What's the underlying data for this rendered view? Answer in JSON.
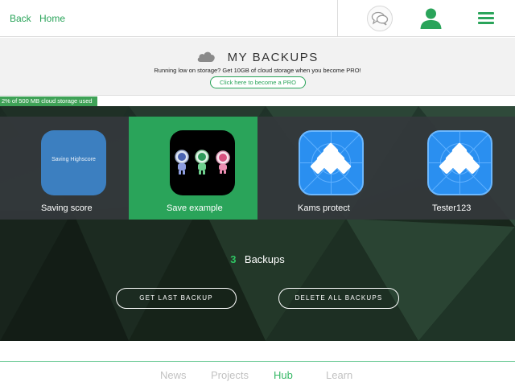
{
  "topbar": {
    "back_label": "Back",
    "home_label": "Home",
    "accent_color": "#2aa45a"
  },
  "banner": {
    "title": "MY BACKUPS",
    "subtitle": "Running low on storage? Get 10GB of cloud storage when you become PRO!",
    "pro_button_label": "Click here to become a PRO"
  },
  "storage": {
    "label": "2% of 500 MB cloud storage used",
    "used_fraction": 0.02
  },
  "projects": [
    {
      "name": "Saving score",
      "icon_caption": "Saving Highscore",
      "icon": "blue-tile-icon",
      "selected": false
    },
    {
      "name": "Save example",
      "icon_caption": "",
      "icon": "astronauts-icon",
      "selected": true
    },
    {
      "name": "Kams protect",
      "icon_caption": "",
      "icon": "cube-pyramid-icon",
      "selected": false
    },
    {
      "name": "Tester123",
      "icon_caption": "",
      "icon": "cube-pyramid-icon",
      "selected": false
    }
  ],
  "backups": {
    "count": "3",
    "label": "Backups",
    "get_last_label": "GET LAST BACKUP",
    "delete_all_label": "DELETE ALL BACKUPS"
  },
  "bottom_nav": {
    "items": [
      {
        "label": "News",
        "active": false
      },
      {
        "label": "Projects",
        "active": false
      },
      {
        "label": "Hub",
        "active": true
      },
      {
        "label": "Learn",
        "active": false
      }
    ],
    "active_color": "#35b865",
    "inactive_color": "#c2c2c2"
  }
}
